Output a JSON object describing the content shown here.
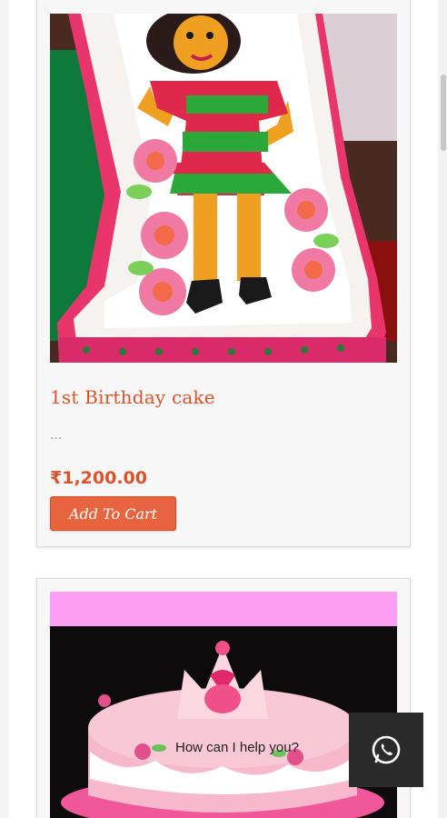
{
  "products": [
    {
      "title": "1st Birthday cake",
      "excerpt": "...",
      "price": "₹1,200.00",
      "button_label": "Add To Cart",
      "image_icon": "birthday-cake-doll-image"
    },
    {
      "image_icon": "pink-crown-cake-image"
    }
  ],
  "chat": {
    "prompt": "How can I help you?",
    "icon": "whatsapp-icon"
  },
  "colors": {
    "accent": "#e8643f",
    "title": "#d9532b",
    "chat_button": "#2b2b2b"
  }
}
